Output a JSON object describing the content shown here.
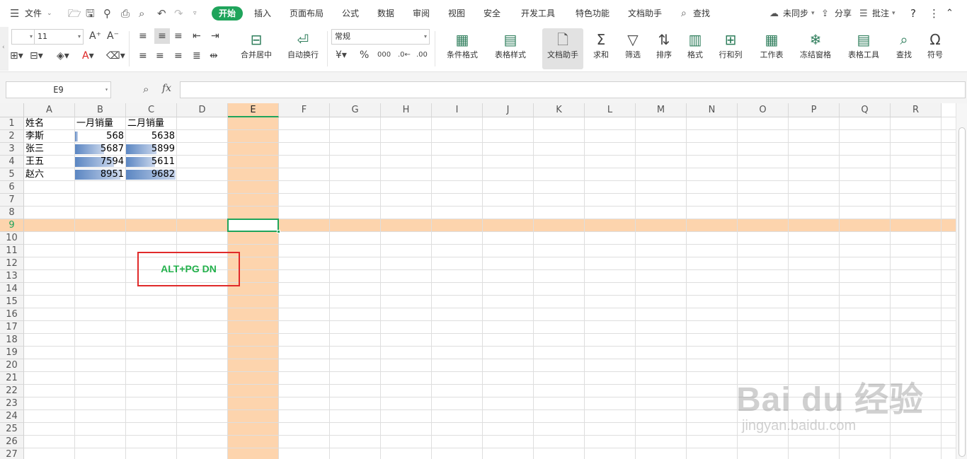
{
  "menu": {
    "file": "文件",
    "tabs": [
      "开始",
      "插入",
      "页面布局",
      "公式",
      "数据",
      "审阅",
      "视图",
      "安全",
      "开发工具",
      "特色功能",
      "文档助手"
    ],
    "search": "查找",
    "sync": "未同步",
    "share": "分享",
    "comment": "批注",
    "help": "?"
  },
  "ribbon": {
    "font_size": "11",
    "number_format": "常规",
    "merge": "合并居中",
    "wrap": "自动换行",
    "cond_format": "条件格式",
    "table_style": "表格样式",
    "doc_helper": "文档助手",
    "sum": "求和",
    "filter": "筛选",
    "sort": "排序",
    "format": "格式",
    "rowcol": "行和列",
    "worksheet": "工作表",
    "freeze": "冻结窗格",
    "table_tools": "表格工具",
    "find": "查找",
    "symbol": "符号"
  },
  "formula_bar": {
    "name_box": "E9",
    "fx": "fx",
    "value": ""
  },
  "columns": [
    "A",
    "B",
    "C",
    "D",
    "E",
    "F",
    "G",
    "H",
    "I",
    "J",
    "K",
    "L",
    "M",
    "N",
    "O",
    "P",
    "Q",
    "R"
  ],
  "rows": [
    "1",
    "2",
    "3",
    "4",
    "5",
    "6",
    "7",
    "8",
    "9",
    "10",
    "11",
    "12",
    "13",
    "14",
    "15",
    "16",
    "17",
    "18",
    "19",
    "20",
    "21",
    "22",
    "23",
    "24",
    "25",
    "26",
    "27"
  ],
  "selected_cell": "E9",
  "highlight_color": "#fdd4ad",
  "accent_color": "#1fa45b",
  "sheet": {
    "header": [
      "姓名",
      "一月销量",
      "二月销量"
    ],
    "data": [
      {
        "name": "李斯",
        "jan": "568",
        "feb": "5638",
        "jan_fill": 0.06,
        "feb_fill": 0.0
      },
      {
        "name": "张三",
        "jan": "5687",
        "feb": "5899",
        "jan_fill": 0.59,
        "feb_fill": 0.61
      },
      {
        "name": "王五",
        "jan": "7594",
        "feb": "5611",
        "jan_fill": 0.78,
        "feb_fill": 0.58
      },
      {
        "name": "赵六",
        "jan": "8951",
        "feb": "9682",
        "jan_fill": 0.92,
        "feb_fill": 1.0
      }
    ]
  },
  "callout": "ALT+PG DN",
  "watermark": {
    "brand": "Bai du 经验",
    "url": "jingyan.baidu.com"
  }
}
